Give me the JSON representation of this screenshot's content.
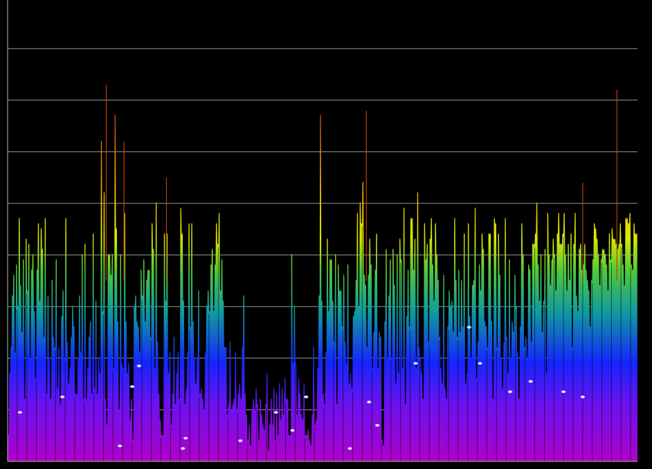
{
  "chart_data": {
    "type": "area",
    "title": "",
    "xlabel": "",
    "ylabel": "",
    "xlim": [
      0,
      460
    ],
    "ylim": [
      0,
      8
    ],
    "grid": true,
    "legend": "none",
    "colors": {
      "background": "#000000",
      "grid": "#9a9a9a",
      "axis": "#bbbbbb",
      "gradient_bottom": "#b000c8",
      "gradient_low": "#6a12f0",
      "gradient_mid_low": "#1426ff",
      "gradient_mid": "#0f9aa0",
      "gradient_mid_high": "#4ec83c",
      "gradient_high": "#d8e800",
      "gradient_top": "#f0b000",
      "gradient_peak": "#c24000"
    },
    "series": [
      {
        "values": [
          0.5,
          1.7,
          2.2,
          3.2,
          3.6,
          2.1,
          3.8,
          3.0,
          4.7,
          3.4,
          2.5,
          3.9,
          1.2,
          4.3,
          3.3,
          4.2,
          2.0,
          3.7,
          4.0,
          2.9,
          1.6,
          3.7,
          4.6,
          3.1,
          4.5,
          4.1,
          2.4,
          4.7,
          1.3,
          3.2,
          2.0,
          1.2,
          3.5,
          2.4,
          2.2,
          3.9,
          1.4,
          2.2,
          1.1,
          2.8,
          3.3,
          2.0,
          4.7,
          2.3,
          1.5,
          1.8,
          2.4,
          3.0,
          2.6,
          1.3,
          1.3,
          2.0,
          3.2,
          2.1,
          4.0,
          1.2,
          4.2,
          1.2,
          1.8,
          2.4,
          2.7,
          1.3,
          4.4,
          1.4,
          3.1,
          1.3,
          2.0,
          1.7,
          6.2,
          2.9,
          5.2,
          1.2,
          0.7,
          4.0,
          4.0,
          3.6,
          4.0,
          1.8,
          6.7,
          4.5,
          2.7,
          1.0,
          4.0,
          1.9,
          1.8,
          4.8,
          2.7,
          1.7,
          1.9,
          0.8,
          1.2,
          0.4,
          3.0,
          3.2,
          2.7,
          2.6,
          2.1,
          3.7,
          3.2,
          3.9,
          2.7,
          3.5,
          3.7,
          3.7,
          2.4,
          4.6,
          4.1,
          1.8,
          5.0,
          2.3,
          1.3,
          0.8,
          0.5,
          0.5,
          4.4,
          3.1,
          4.4,
          1.7,
          2.1,
          0.7,
          1.3,
          2.4,
          1.1,
          1.7,
          2.1,
          1.2,
          4.9,
          4.4,
          3.1,
          1.1,
          1.4,
          2.1,
          4.6,
          2.6,
          4.6,
          2.7,
          2.0,
          1.5,
          2.0,
          3.3,
          1.3,
          1.4,
          1.2,
          1.0,
          2.1,
          3.0,
          3.3,
          2.9,
          3.8,
          4.1,
          2.9,
          3.8,
          4.6,
          4.2,
          4.8,
          3.3,
          3.9,
          3.1,
          2.2,
          2.2,
          0.9,
          1.1,
          2.3,
          1.0,
          1.1,
          1.2,
          2.1,
          1.0,
          1.3,
          1.5,
          1.2,
          2.2,
          3.2,
          1.3,
          0.9,
          0.4,
          0.7,
          0.3,
          1.0,
          1.2,
          1.0,
          1.4,
          1.1,
          0.4,
          1.2,
          0.9,
          0.7,
          0.6,
          1.1,
          1.7,
          0.2,
          0.7,
          1.2,
          0.7,
          1.4,
          0.4,
          1.3,
          0.5,
          1.5,
          0.8,
          1.4,
          0.9,
          1.6,
          1.2,
          1.2,
          0.5,
          0.5,
          4.0,
          1.9,
          3.0,
          1.9,
          0.9,
          1.6,
          1.3,
          0.9,
          0.8,
          1.5,
          0.5,
          0.5,
          0.6,
          0.4,
          0.3,
          0.9,
          2.2,
          0.7,
          0.8,
          1.8,
          3.2,
          6.7,
          3.1,
          1.3,
          1.1,
          2.1,
          4.3,
          2.9,
          3.9,
          3.9,
          3.1,
          2.3,
          4.0,
          1.1,
          3.8,
          3.3,
          3.3,
          2.6,
          3.6,
          2.3,
          1.9,
          3.8,
          1.5,
          1.7,
          1.4,
          2.8,
          2.9,
          3.5,
          4.8,
          3.0,
          5.0,
          4.6,
          5.4,
          3.6,
          3.4,
          2.2,
          3.6,
          4.3,
          3.8,
          1.8,
          2.5,
          3.7,
          4.4,
          1.8,
          2.5,
          2.4,
          0.4,
          0.3,
          2.7,
          4.1,
          2.0,
          3.2,
          3.9,
          2.0,
          4.1,
          3.4,
          1.5,
          4.0,
          1.7,
          4.3,
          3.9,
          1.8,
          4.9,
          1.1,
          2.8,
          3.7,
          2.6,
          4.7,
          4.7,
          3.7,
          4.3,
          1.8,
          5.2,
          2.2,
          2.0,
          1.7,
          1.2,
          4.6,
          3.9,
          4.2,
          2.3,
          4.3,
          4.7,
          3.8,
          3.1,
          4.6,
          4.0,
          3.5,
          2.4,
          1.8,
          1.5,
          3.6,
          1.4,
          1.2,
          2.6,
          3.3,
          3.0,
          3.1,
          2.5,
          4.7,
          3.5,
          2.4,
          3.7,
          2.5,
          3.5,
          2.6,
          4.4,
          1.5,
          1.7,
          4.6,
          2.8,
          2.0,
          3.4,
          3.5,
          4.9,
          1.6,
          2.3,
          3.8,
          3.3,
          4.4,
          4.1,
          2.7,
          2.6,
          2.2,
          4.4,
          4.4,
          2.7,
          1.2,
          4.7,
          4.6,
          2.2,
          4.4,
          3.6,
          2.0,
          1.4,
          2.3,
          4.7,
          2.4,
          1.7,
          3.9,
          2.0,
          2.7,
          2.5,
          3.6,
          3.0,
          2.1,
          1.2,
          2.6,
          4.6,
          4.0,
          2.2,
          2.4,
          2.0,
          3.8,
          3.7,
          2.3,
          4.2,
          4.2,
          4.4,
          5.0,
          3.8,
          3.1,
          4.0,
          2.5,
          3.1,
          4.1,
          1.7,
          4.8,
          4.0,
          3.4,
          3.9,
          4.3,
          4.0,
          3.3,
          4.4,
          4.8,
          4.2,
          4.2,
          4.4,
          4.8,
          4.0,
          3.3,
          4.2,
          3.5,
          4.4,
          2.2,
          4.2,
          4.8,
          3.2,
          2.9,
          4.1,
          4.2,
          3.7,
          3.8,
          4.2,
          3.7,
          3.5,
          3.3,
          2.6,
          3.5,
          3.9,
          4.6,
          4.5,
          4.3,
          4.0,
          3.4,
          3.9,
          4.1,
          4.1,
          4.0,
          3.8,
          3.3,
          4.4,
          3.9,
          4.5,
          4.3,
          4.3,
          4.2,
          4.1,
          4.2,
          4.6,
          4.2,
          3.8,
          3.4,
          4.7,
          4.7,
          4.6,
          4.8,
          3.8,
          3.7,
          4.6,
          4.4,
          4.4
        ],
        "spikes": [
          {
            "x": 72,
            "value": 7.3
          },
          {
            "x": 85,
            "value": 6.2
          },
          {
            "x": 116,
            "value": 5.5
          },
          {
            "x": 262,
            "value": 6.8
          },
          {
            "x": 445,
            "value": 7.2
          },
          {
            "x": 420,
            "value": 5.4
          }
        ],
        "markers": [
          {
            "x": 9,
            "value": 0.95
          },
          {
            "x": 40,
            "value": 1.25
          },
          {
            "x": 82,
            "value": 0.3
          },
          {
            "x": 91,
            "value": 1.45
          },
          {
            "x": 96,
            "value": 1.85
          },
          {
            "x": 128,
            "value": 0.25
          },
          {
            "x": 130,
            "value": 0.45
          },
          {
            "x": 170,
            "value": 0.4
          },
          {
            "x": 196,
            "value": 0.95
          },
          {
            "x": 208,
            "value": 0.6
          },
          {
            "x": 218,
            "value": 1.25
          },
          {
            "x": 250,
            "value": 0.25
          },
          {
            "x": 264,
            "value": 1.15
          },
          {
            "x": 270,
            "value": 0.7
          },
          {
            "x": 298,
            "value": 1.9
          },
          {
            "x": 337,
            "value": 2.6
          },
          {
            "x": 345,
            "value": 1.9
          },
          {
            "x": 367,
            "value": 1.35
          },
          {
            "x": 382,
            "value": 1.55
          },
          {
            "x": 406,
            "value": 1.35
          },
          {
            "x": 420,
            "value": 1.25
          }
        ]
      }
    ]
  }
}
